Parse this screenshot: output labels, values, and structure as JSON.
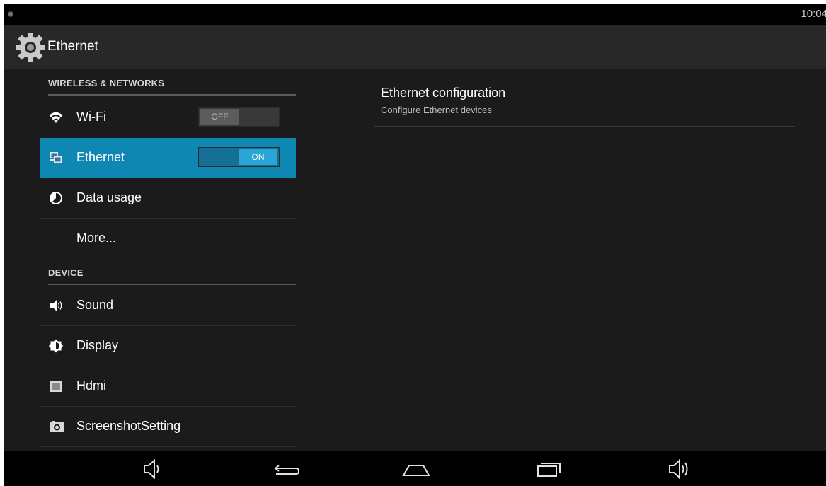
{
  "status_bar": {
    "time": "10:04"
  },
  "action_bar": {
    "title": "Ethernet",
    "icon": "gear-icon"
  },
  "settings_list": {
    "sections": [
      {
        "header": "WIRELESS & NETWORKS"
      },
      {
        "header": "DEVICE"
      }
    ],
    "items": [
      {
        "label": "Wi-Fi",
        "icon": "wifi-icon",
        "toggle": "OFF"
      },
      {
        "label": "Ethernet",
        "icon": "ethernet-icon",
        "toggle": "ON",
        "selected": true
      },
      {
        "label": "Data usage",
        "icon": "data-usage-icon"
      },
      {
        "label": "More..."
      },
      {
        "label": "Sound",
        "icon": "sound-icon"
      },
      {
        "label": "Display",
        "icon": "display-icon"
      },
      {
        "label": "Hdmi",
        "icon": "hdmi-icon"
      },
      {
        "label": "ScreenshotSetting",
        "icon": "camera-icon"
      }
    ]
  },
  "detail": {
    "title": "Ethernet configuration",
    "summary": "Configure Ethernet devices"
  },
  "nav_bar": {
    "buttons": [
      "volume-down-icon",
      "back-icon",
      "home-icon",
      "recent-apps-icon",
      "volume-up-icon"
    ]
  },
  "colors": {
    "accent": "#0e87b3",
    "toggle_on": "#2aa6d6",
    "background": "#1b1b1b"
  }
}
